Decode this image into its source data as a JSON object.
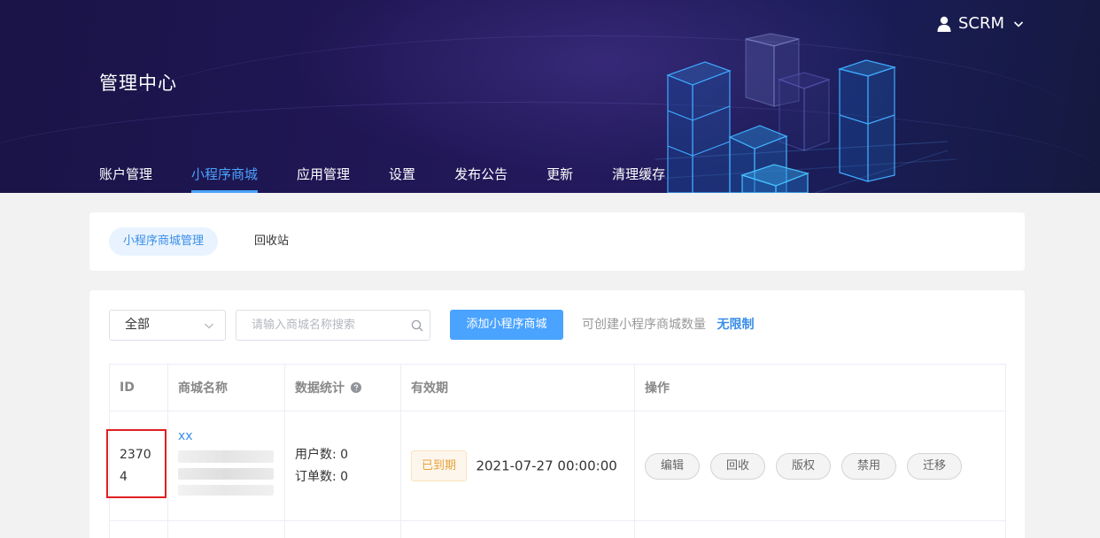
{
  "header": {
    "title": "管理中心",
    "user": "SCRM",
    "nav": [
      "账户管理",
      "小程序商城",
      "应用管理",
      "设置",
      "发布公告",
      "更新",
      "清理缓存"
    ],
    "active_nav": 1
  },
  "tabs": {
    "items": [
      "小程序商城管理",
      "回收站"
    ],
    "active": 0
  },
  "toolbar": {
    "filter_value": "全部",
    "search_placeholder": "请输入商城名称搜索",
    "add_button": "添加小程序商城",
    "quota_label": "可创建小程序商城数量",
    "quota_value": "无限制"
  },
  "table": {
    "columns": [
      "ID",
      "商城名称",
      "数据统计",
      "有效期",
      "操作"
    ],
    "rows": [
      {
        "id": "23704",
        "name": "xx",
        "users": "用户数: 0",
        "orders": "订单数: 0",
        "status": "已到期",
        "expiry": "2021-07-27 00:00:00",
        "actions": [
          "编辑",
          "回收",
          "版权",
          "禁用",
          "迁移"
        ]
      }
    ]
  },
  "colors": {
    "accent": "#4aa3ff",
    "link": "#3a8ee6",
    "warning": "#e6a23c",
    "highlight": "#e02020",
    "banner": "#1f1653"
  },
  "icons": {
    "user": "user-icon",
    "dropdown": "chevron-down-icon",
    "search": "search-icon",
    "help": "question-circle-icon"
  }
}
